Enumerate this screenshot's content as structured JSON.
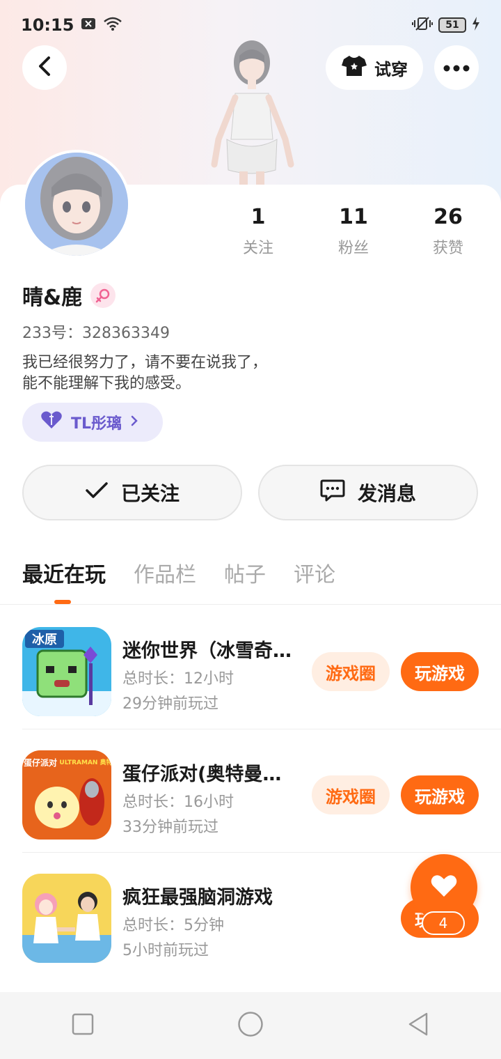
{
  "status_bar": {
    "time": "10:15",
    "battery": "51"
  },
  "header": {
    "try_on_label": "试穿"
  },
  "profile": {
    "stats": [
      {
        "value": "1",
        "label": "关注"
      },
      {
        "value": "11",
        "label": "粉丝"
      },
      {
        "value": "26",
        "label": "获赞"
      }
    ],
    "name": "晴&鹿",
    "uid": "233号：328363349",
    "bio_line1": "我已经很努力了，请不要在说我了，",
    "bio_line2": "能不能理解下我的感受。",
    "guild": "TL彤璃",
    "follow_label": "已关注",
    "message_label": "发消息"
  },
  "tabs": [
    {
      "label": "最近在玩"
    },
    {
      "label": "作品栏"
    },
    {
      "label": "帖子"
    },
    {
      "label": "评论"
    }
  ],
  "games": [
    {
      "title": "迷你世界（冰雪奇…",
      "duration": "总时长：12小时",
      "last_played": "29分钟前玩过",
      "icon_text": "冰原",
      "circle_label": "游戏圈",
      "play_label": "玩游戏"
    },
    {
      "title": "蛋仔派对(奥特曼联…",
      "duration": "总时长：16小时",
      "last_played": "33分钟前玩过",
      "icon_text": "蛋仔派对",
      "icon_text2": "ULTRAMAN 奥特曼",
      "circle_label": "游戏圈",
      "play_label": "玩游戏"
    },
    {
      "title": "疯狂最强脑洞游戏",
      "duration": "总时长：5分钟",
      "last_played": "5小时前玩过",
      "play_label": "玩"
    }
  ],
  "fab": {
    "count": "4"
  },
  "colors": {
    "accent": "#ff6a13",
    "accent_light": "#ffeee2",
    "guild_purple": "#6a5acd"
  }
}
